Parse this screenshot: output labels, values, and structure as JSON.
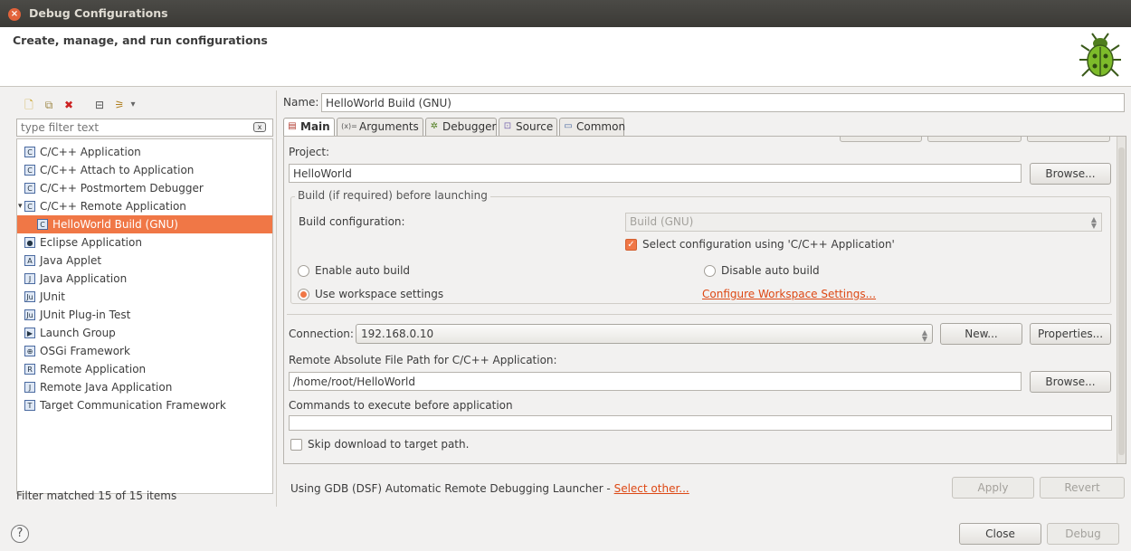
{
  "window": {
    "title": "Debug Configurations",
    "close_glyph": "×"
  },
  "header": {
    "title": "Create, manage, and run configurations",
    "icon": "bug-icon"
  },
  "left": {
    "toolbar": [
      {
        "name": "new-configuration-icon",
        "glyph": "🗋"
      },
      {
        "name": "duplicate-icon",
        "glyph": "⧉"
      },
      {
        "name": "delete-icon",
        "glyph": "✖"
      },
      {
        "name": "collapse-all-icon",
        "glyph": "⊟"
      },
      {
        "name": "filter-icon",
        "glyph": "⚞"
      },
      {
        "name": "dropdown-arrow-icon",
        "glyph": "▾"
      }
    ],
    "filter_placeholder": "type filter text",
    "tree": [
      {
        "label": "C/C++ Application",
        "icon": "C",
        "indent": 0,
        "expander": ""
      },
      {
        "label": "C/C++ Attach to Application",
        "icon": "C",
        "indent": 0,
        "expander": ""
      },
      {
        "label": "C/C++ Postmortem Debugger",
        "icon": "C",
        "indent": 0,
        "expander": ""
      },
      {
        "label": "C/C++ Remote Application",
        "icon": "C",
        "indent": 0,
        "expander": "▾"
      },
      {
        "label": "HelloWorld Build (GNU)",
        "icon": "C",
        "indent": 1,
        "expander": "",
        "selected": true
      },
      {
        "label": "Eclipse Application",
        "icon": "●",
        "indent": 0,
        "expander": ""
      },
      {
        "label": "Java Applet",
        "icon": "A",
        "indent": 0,
        "expander": ""
      },
      {
        "label": "Java Application",
        "icon": "J",
        "indent": 0,
        "expander": ""
      },
      {
        "label": "JUnit",
        "icon": "Ju",
        "indent": 0,
        "expander": ""
      },
      {
        "label": "JUnit Plug-in Test",
        "icon": "Ju",
        "indent": 0,
        "expander": ""
      },
      {
        "label": "Launch Group",
        "icon": "▶",
        "indent": 0,
        "expander": ""
      },
      {
        "label": "OSGi Framework",
        "icon": "⊕",
        "indent": 0,
        "expander": ""
      },
      {
        "label": "Remote Application",
        "icon": "R",
        "indent": 0,
        "expander": ""
      },
      {
        "label": "Remote Java Application",
        "icon": "J",
        "indent": 0,
        "expander": ""
      },
      {
        "label": "Target Communication Framework",
        "icon": "T",
        "indent": 0,
        "expander": ""
      }
    ],
    "status": "Filter matched 15 of 15 items"
  },
  "right": {
    "name_label": "Name:",
    "name_value": "HelloWorld Build (GNU)",
    "tabs": [
      {
        "label": "Main",
        "icon": "▤",
        "active": true
      },
      {
        "label": "Arguments",
        "icon": "(x)=",
        "active": false
      },
      {
        "label": "Debugger",
        "icon": "✲",
        "active": false
      },
      {
        "label": "Source",
        "icon": "⊡",
        "active": false
      },
      {
        "label": "Common",
        "icon": "▭",
        "active": false
      }
    ],
    "project_label": "Project:",
    "project_value": "HelloWorld",
    "browse_label": "Browse...",
    "build_group_label": "Build (if required) before launching",
    "build_config_label": "Build configuration:",
    "build_config_value": "Build (GNU)",
    "select_config_label": "Select configuration using 'C/C++ Application'",
    "enable_auto_build": "Enable auto build",
    "disable_auto_build": "Disable auto build",
    "use_workspace_settings": "Use workspace settings",
    "configure_workspace_link": "Configure Workspace Settings...",
    "connection_label": "Connection:",
    "connection_value": "192.168.0.10",
    "new_label": "New...",
    "properties_label": "Properties...",
    "remote_path_label": "Remote Absolute File Path for C/C++ Application:",
    "remote_path_value": "/home/root/HelloWorld",
    "browse2_label": "Browse...",
    "commands_label": "Commands to execute before application",
    "commands_value": "",
    "skip_download_label": "Skip download to target path.",
    "launcher_text": "Using GDB (DSF) Automatic Remote Debugging Launcher - ",
    "select_other_link": "Select other...",
    "apply_label": "Apply",
    "revert_label": "Revert"
  },
  "footer": {
    "help_glyph": "?",
    "close_label": "Close",
    "debug_label": "Debug"
  }
}
